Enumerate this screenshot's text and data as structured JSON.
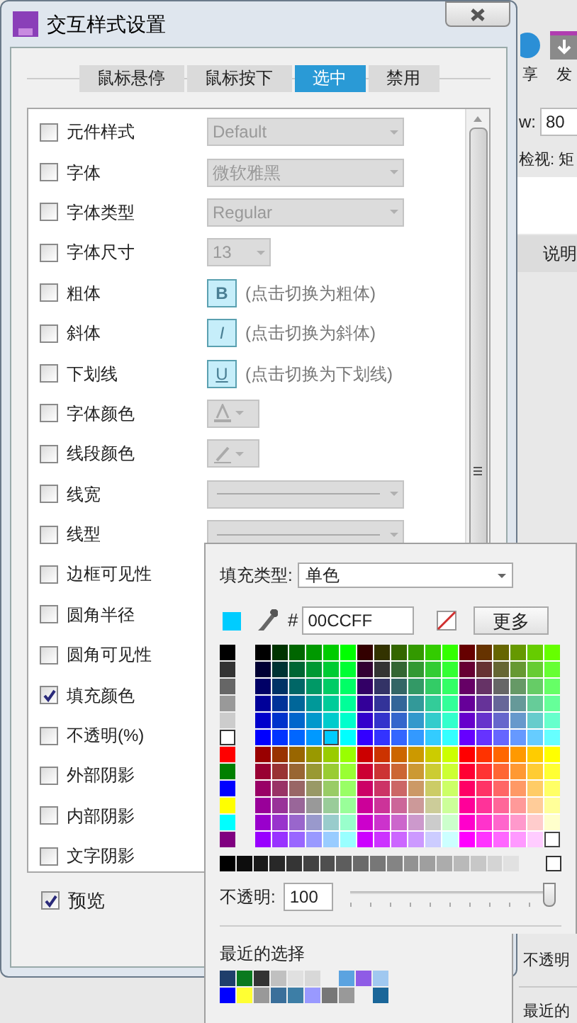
{
  "window": {
    "title": "交互样式设置"
  },
  "tabs": [
    {
      "label": "鼠标悬停",
      "selected": false
    },
    {
      "label": "鼠标按下",
      "selected": false
    },
    {
      "label": "选中",
      "selected": true
    },
    {
      "label": "禁用",
      "selected": false
    }
  ],
  "properties": [
    {
      "label": "元件样式",
      "checked": false,
      "kind": "select",
      "value": "Default"
    },
    {
      "label": "字体",
      "checked": false,
      "kind": "select",
      "value": "微软雅黑"
    },
    {
      "label": "字体类型",
      "checked": false,
      "kind": "select",
      "value": "Regular"
    },
    {
      "label": "字体尺寸",
      "checked": false,
      "kind": "small-select",
      "value": "13"
    },
    {
      "label": "粗体",
      "checked": false,
      "kind": "bold-toggle",
      "glyph": "B",
      "hint": "(点击切换为粗体)"
    },
    {
      "label": "斜体",
      "checked": false,
      "kind": "italic-toggle",
      "glyph": "I",
      "hint": "(点击切换为斜体)"
    },
    {
      "label": "下划线",
      "checked": false,
      "kind": "underline-toggle",
      "glyph": "U",
      "hint": "(点击切换为下划线)"
    },
    {
      "label": "字体颜色",
      "checked": false,
      "kind": "text-color"
    },
    {
      "label": "线段颜色",
      "checked": false,
      "kind": "line-color"
    },
    {
      "label": "线宽",
      "checked": false,
      "kind": "line-select"
    },
    {
      "label": "线型",
      "checked": false,
      "kind": "line-select"
    },
    {
      "label": "边框可见性",
      "checked": false,
      "kind": "plain"
    },
    {
      "label": "圆角半径",
      "checked": false,
      "kind": "plain"
    },
    {
      "label": "圆角可见性",
      "checked": false,
      "kind": "plain"
    },
    {
      "label": "填充颜色",
      "checked": true,
      "kind": "plain"
    },
    {
      "label": "不透明(%)",
      "checked": false,
      "kind": "plain"
    },
    {
      "label": "外部阴影",
      "checked": false,
      "kind": "plain"
    },
    {
      "label": "内部阴影",
      "checked": false,
      "kind": "plain"
    },
    {
      "label": "文字阴影",
      "checked": false,
      "kind": "plain"
    }
  ],
  "preview": {
    "label": "预览",
    "checked": true
  },
  "fill_popup": {
    "fill_type_label": "填充类型:",
    "fill_type": "单色",
    "hex_prefix": "#",
    "hex": "00CCFF",
    "more_button": "更多",
    "opacity_label": "不透明:",
    "opacity": "100",
    "level": 1,
    "recent_label": "最近的选择",
    "recent_colors": [
      {
        "color": "#1f3f6b"
      },
      {
        "color": "#0a7a1f"
      },
      {
        "color": "#333333"
      },
      {
        "color": "#c0c0c0"
      },
      {
        "color": "#e0e0e0"
      },
      {
        "color": "#d8d8d8"
      },
      {
        "kind": "empty"
      },
      {
        "color": "#5ba3e0"
      },
      {
        "color": "#8f5ce6"
      },
      {
        "color": "#a0c8f0"
      },
      {
        "color": "#0000ff"
      },
      {
        "color": "#ffff33"
      },
      {
        "color": "#999999"
      },
      {
        "color": "#3a6f9a"
      },
      {
        "color": "#3d7ea6"
      },
      {
        "color": "#9999ff"
      },
      {
        "color": "#777777"
      },
      {
        "color": "#999999"
      },
      {
        "kind": "empty"
      },
      {
        "color": "#1a6699"
      }
    ]
  },
  "background_app": {
    "toolbar": [
      {
        "label": "享"
      },
      {
        "label": "发"
      }
    ],
    "width_label": "w:",
    "width_value": "80",
    "inspector_label": "检视: 矩",
    "tab": "说明",
    "opacity_label": "不透明",
    "recent_label": "最近的"
  }
}
